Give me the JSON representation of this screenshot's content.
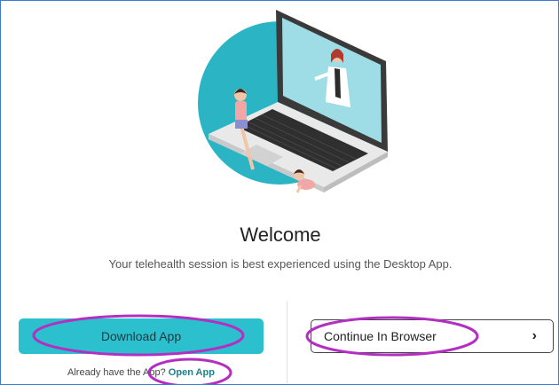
{
  "welcome": {
    "title": "Welcome",
    "subtitle": "Your telehealth session is best experienced using the Desktop App."
  },
  "actions": {
    "download_label": "Download App",
    "browser_label": "Continue In Browser",
    "browser_chevron": "›",
    "already_prefix": "Already have the App?",
    "open_app_label": "Open App"
  },
  "colors": {
    "accent": "#2cbfce",
    "link": "#1d7f8d",
    "annotation": "#b32fc2",
    "frame": "#3a7bd5"
  },
  "icons": {
    "hero": "telehealth-laptop-illustration",
    "browser_button": "chevron-right-icon"
  }
}
